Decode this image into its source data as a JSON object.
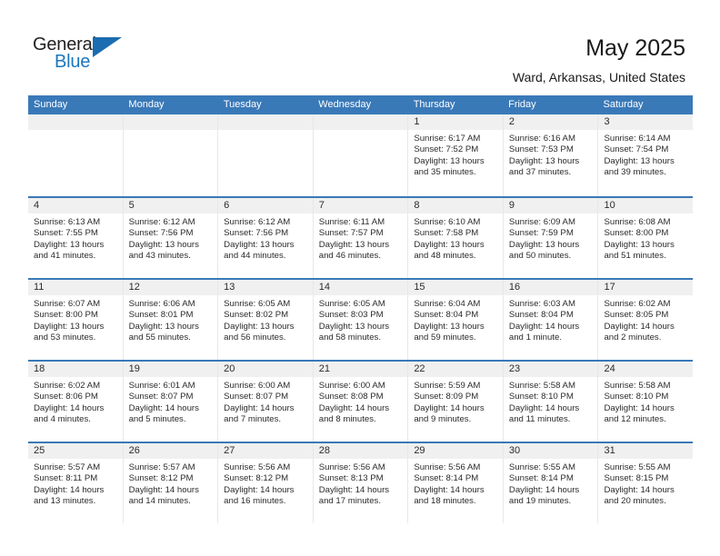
{
  "brand": {
    "name_dark": "General",
    "name_blue": "Blue",
    "accent_color": "#1b76bc",
    "triangle_color": "#1b6cb0"
  },
  "header": {
    "title": "May 2025",
    "location": "Ward, Arkansas, United States"
  },
  "calendar": {
    "header_bg": "#3a79b8",
    "daynum_bg": "#f0f0f0",
    "weekdays": [
      "Sunday",
      "Monday",
      "Tuesday",
      "Wednesday",
      "Thursday",
      "Friday",
      "Saturday"
    ],
    "weeks": [
      [
        {
          "day": "",
          "sunrise": "",
          "sunset": "",
          "daylight": "",
          "empty": true
        },
        {
          "day": "",
          "sunrise": "",
          "sunset": "",
          "daylight": "",
          "empty": true
        },
        {
          "day": "",
          "sunrise": "",
          "sunset": "",
          "daylight": "",
          "empty": true
        },
        {
          "day": "",
          "sunrise": "",
          "sunset": "",
          "daylight": "",
          "empty": true
        },
        {
          "day": "1",
          "sunrise": "Sunrise: 6:17 AM",
          "sunset": "Sunset: 7:52 PM",
          "daylight": "Daylight: 13 hours and 35 minutes.",
          "empty": false
        },
        {
          "day": "2",
          "sunrise": "Sunrise: 6:16 AM",
          "sunset": "Sunset: 7:53 PM",
          "daylight": "Daylight: 13 hours and 37 minutes.",
          "empty": false
        },
        {
          "day": "3",
          "sunrise": "Sunrise: 6:14 AM",
          "sunset": "Sunset: 7:54 PM",
          "daylight": "Daylight: 13 hours and 39 minutes.",
          "empty": false
        }
      ],
      [
        {
          "day": "4",
          "sunrise": "Sunrise: 6:13 AM",
          "sunset": "Sunset: 7:55 PM",
          "daylight": "Daylight: 13 hours and 41 minutes.",
          "empty": false
        },
        {
          "day": "5",
          "sunrise": "Sunrise: 6:12 AM",
          "sunset": "Sunset: 7:56 PM",
          "daylight": "Daylight: 13 hours and 43 minutes.",
          "empty": false
        },
        {
          "day": "6",
          "sunrise": "Sunrise: 6:12 AM",
          "sunset": "Sunset: 7:56 PM",
          "daylight": "Daylight: 13 hours and 44 minutes.",
          "empty": false
        },
        {
          "day": "7",
          "sunrise": "Sunrise: 6:11 AM",
          "sunset": "Sunset: 7:57 PM",
          "daylight": "Daylight: 13 hours and 46 minutes.",
          "empty": false
        },
        {
          "day": "8",
          "sunrise": "Sunrise: 6:10 AM",
          "sunset": "Sunset: 7:58 PM",
          "daylight": "Daylight: 13 hours and 48 minutes.",
          "empty": false
        },
        {
          "day": "9",
          "sunrise": "Sunrise: 6:09 AM",
          "sunset": "Sunset: 7:59 PM",
          "daylight": "Daylight: 13 hours and 50 minutes.",
          "empty": false
        },
        {
          "day": "10",
          "sunrise": "Sunrise: 6:08 AM",
          "sunset": "Sunset: 8:00 PM",
          "daylight": "Daylight: 13 hours and 51 minutes.",
          "empty": false
        }
      ],
      [
        {
          "day": "11",
          "sunrise": "Sunrise: 6:07 AM",
          "sunset": "Sunset: 8:00 PM",
          "daylight": "Daylight: 13 hours and 53 minutes.",
          "empty": false
        },
        {
          "day": "12",
          "sunrise": "Sunrise: 6:06 AM",
          "sunset": "Sunset: 8:01 PM",
          "daylight": "Daylight: 13 hours and 55 minutes.",
          "empty": false
        },
        {
          "day": "13",
          "sunrise": "Sunrise: 6:05 AM",
          "sunset": "Sunset: 8:02 PM",
          "daylight": "Daylight: 13 hours and 56 minutes.",
          "empty": false
        },
        {
          "day": "14",
          "sunrise": "Sunrise: 6:05 AM",
          "sunset": "Sunset: 8:03 PM",
          "daylight": "Daylight: 13 hours and 58 minutes.",
          "empty": false
        },
        {
          "day": "15",
          "sunrise": "Sunrise: 6:04 AM",
          "sunset": "Sunset: 8:04 PM",
          "daylight": "Daylight: 13 hours and 59 minutes.",
          "empty": false
        },
        {
          "day": "16",
          "sunrise": "Sunrise: 6:03 AM",
          "sunset": "Sunset: 8:04 PM",
          "daylight": "Daylight: 14 hours and 1 minute.",
          "empty": false
        },
        {
          "day": "17",
          "sunrise": "Sunrise: 6:02 AM",
          "sunset": "Sunset: 8:05 PM",
          "daylight": "Daylight: 14 hours and 2 minutes.",
          "empty": false
        }
      ],
      [
        {
          "day": "18",
          "sunrise": "Sunrise: 6:02 AM",
          "sunset": "Sunset: 8:06 PM",
          "daylight": "Daylight: 14 hours and 4 minutes.",
          "empty": false
        },
        {
          "day": "19",
          "sunrise": "Sunrise: 6:01 AM",
          "sunset": "Sunset: 8:07 PM",
          "daylight": "Daylight: 14 hours and 5 minutes.",
          "empty": false
        },
        {
          "day": "20",
          "sunrise": "Sunrise: 6:00 AM",
          "sunset": "Sunset: 8:07 PM",
          "daylight": "Daylight: 14 hours and 7 minutes.",
          "empty": false
        },
        {
          "day": "21",
          "sunrise": "Sunrise: 6:00 AM",
          "sunset": "Sunset: 8:08 PM",
          "daylight": "Daylight: 14 hours and 8 minutes.",
          "empty": false
        },
        {
          "day": "22",
          "sunrise": "Sunrise: 5:59 AM",
          "sunset": "Sunset: 8:09 PM",
          "daylight": "Daylight: 14 hours and 9 minutes.",
          "empty": false
        },
        {
          "day": "23",
          "sunrise": "Sunrise: 5:58 AM",
          "sunset": "Sunset: 8:10 PM",
          "daylight": "Daylight: 14 hours and 11 minutes.",
          "empty": false
        },
        {
          "day": "24",
          "sunrise": "Sunrise: 5:58 AM",
          "sunset": "Sunset: 8:10 PM",
          "daylight": "Daylight: 14 hours and 12 minutes.",
          "empty": false
        }
      ],
      [
        {
          "day": "25",
          "sunrise": "Sunrise: 5:57 AM",
          "sunset": "Sunset: 8:11 PM",
          "daylight": "Daylight: 14 hours and 13 minutes.",
          "empty": false
        },
        {
          "day": "26",
          "sunrise": "Sunrise: 5:57 AM",
          "sunset": "Sunset: 8:12 PM",
          "daylight": "Daylight: 14 hours and 14 minutes.",
          "empty": false
        },
        {
          "day": "27",
          "sunrise": "Sunrise: 5:56 AM",
          "sunset": "Sunset: 8:12 PM",
          "daylight": "Daylight: 14 hours and 16 minutes.",
          "empty": false
        },
        {
          "day": "28",
          "sunrise": "Sunrise: 5:56 AM",
          "sunset": "Sunset: 8:13 PM",
          "daylight": "Daylight: 14 hours and 17 minutes.",
          "empty": false
        },
        {
          "day": "29",
          "sunrise": "Sunrise: 5:56 AM",
          "sunset": "Sunset: 8:14 PM",
          "daylight": "Daylight: 14 hours and 18 minutes.",
          "empty": false
        },
        {
          "day": "30",
          "sunrise": "Sunrise: 5:55 AM",
          "sunset": "Sunset: 8:14 PM",
          "daylight": "Daylight: 14 hours and 19 minutes.",
          "empty": false
        },
        {
          "day": "31",
          "sunrise": "Sunrise: 5:55 AM",
          "sunset": "Sunset: 8:15 PM",
          "daylight": "Daylight: 14 hours and 20 minutes.",
          "empty": false
        }
      ]
    ]
  }
}
